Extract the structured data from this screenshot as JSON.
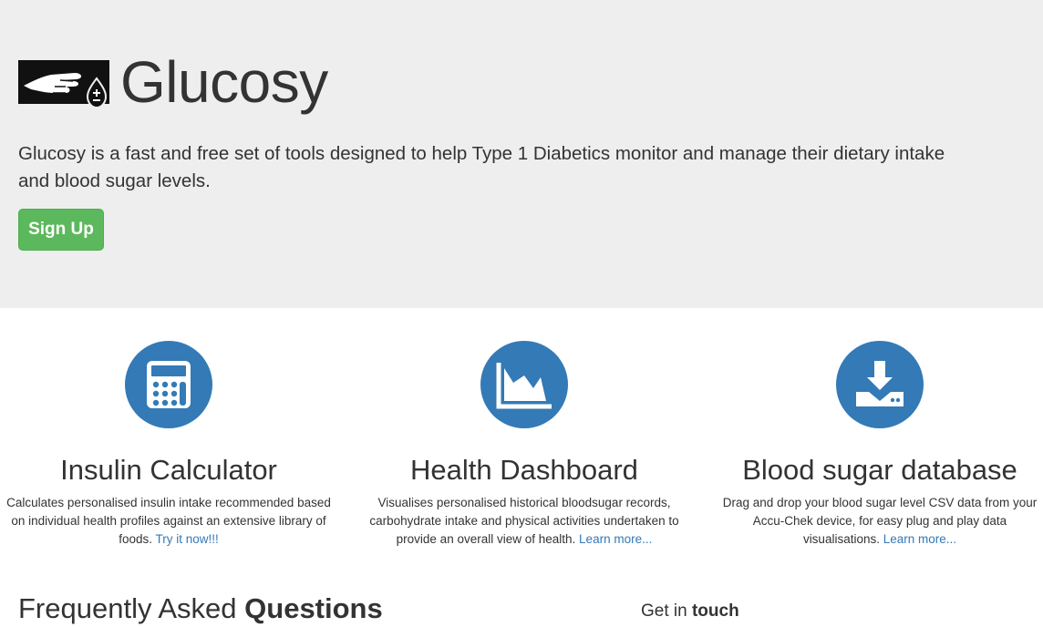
{
  "hero": {
    "logo_icon": "pointing-hand-blood-drop-icon",
    "brand_name": "Glucosy",
    "intro": "Glucosy is a fast and free set of tools designed to help Type 1 Diabetics monitor and manage their dietary intake and blood sugar levels.",
    "signup_label": "Sign Up",
    "signup_color": "#5cb85c"
  },
  "features": [
    {
      "icon": "calculator-icon",
      "title": "Insulin Calculator",
      "description": "Calculates personalised insulin intake recommended based on individual health profiles against an extensive library of foods.",
      "link": "Try it now!!!"
    },
    {
      "icon": "area-chart-icon",
      "title": "Health Dashboard",
      "description": "Visualises personalised historical bloodsugar records, carbohydrate intake and physical activities undertaken to provide an overall view of health.",
      "link": "Learn more..."
    },
    {
      "icon": "download-icon",
      "title": "Blood sugar database",
      "description": "Drag and drop your blood sugar level CSV data from your Accu-Chek device, for easy plug and play data visualisations.",
      "link": "Learn more..."
    }
  ],
  "faq": {
    "title_plain": "Frequently Asked",
    "title_bold": "Questions"
  },
  "contact": {
    "title_plain": "Get in",
    "title_bold": "touch"
  },
  "colors": {
    "accent": "#337ab7",
    "hero_bg": "#eeeeee"
  }
}
